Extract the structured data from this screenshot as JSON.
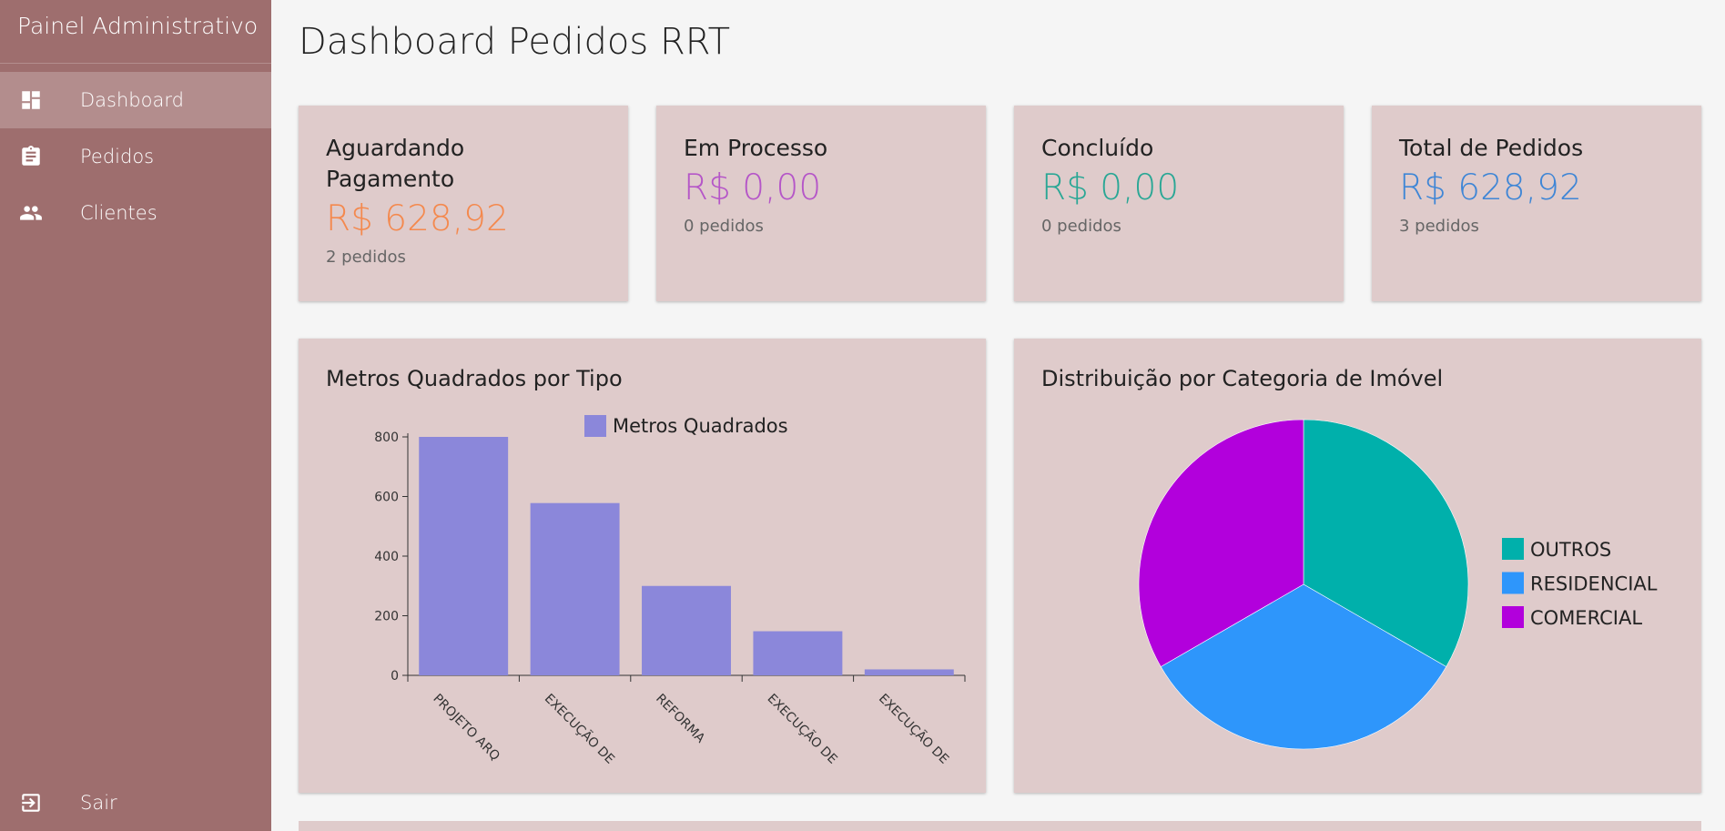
{
  "sidebar": {
    "title": "Painel Administrativo",
    "items": [
      {
        "label": "Dashboard",
        "icon": "dashboard-icon",
        "active": true
      },
      {
        "label": "Pedidos",
        "icon": "clipboard-icon",
        "active": false
      },
      {
        "label": "Clientes",
        "icon": "people-icon",
        "active": false
      }
    ],
    "logout": {
      "label": "Sair",
      "icon": "logout-icon"
    }
  },
  "page": {
    "title": "Dashboard Pedidos RRT"
  },
  "stats": [
    {
      "title": "Aguardando Pagamento",
      "value": "R$ 628,92",
      "sub": "2 pedidos",
      "color": "#f4894e"
    },
    {
      "title": "Em Processo",
      "value": "R$ 0,00",
      "sub": "0 pedidos",
      "color": "#b556c8"
    },
    {
      "title": "Concluído",
      "value": "R$ 0,00",
      "sub": "0 pedidos",
      "color": "#2aa795"
    },
    {
      "title": "Total de Pedidos",
      "value": "R$ 628,92",
      "sub": "3 pedidos",
      "color": "#3f86d6"
    }
  ],
  "chart_data": [
    {
      "type": "bar",
      "title": "Metros Quadrados por Tipo",
      "categories": [
        "PROJETO ARQ",
        "EXECUÇÃO DE",
        "REFORMA",
        "EXECUÇÃO DE",
        "EXECUÇÃO DE"
      ],
      "series": [
        {
          "name": "Metros Quadrados",
          "values": [
            800,
            578,
            300,
            148,
            20
          ],
          "color": "#8b87da"
        }
      ],
      "yticks": [
        0,
        200,
        400,
        600,
        800
      ],
      "ylim": [
        0,
        800
      ],
      "legend": "top",
      "grid": false
    },
    {
      "type": "pie",
      "title": "Distribuição por Categoria de Imóvel",
      "labels": [
        "OUTROS",
        "RESIDENCIAL",
        "COMERCIAL"
      ],
      "values": [
        1,
        1,
        1
      ],
      "colors": [
        "#00b0ab",
        "#2e96fb",
        "#b200dc"
      ],
      "legend": "right"
    }
  ]
}
